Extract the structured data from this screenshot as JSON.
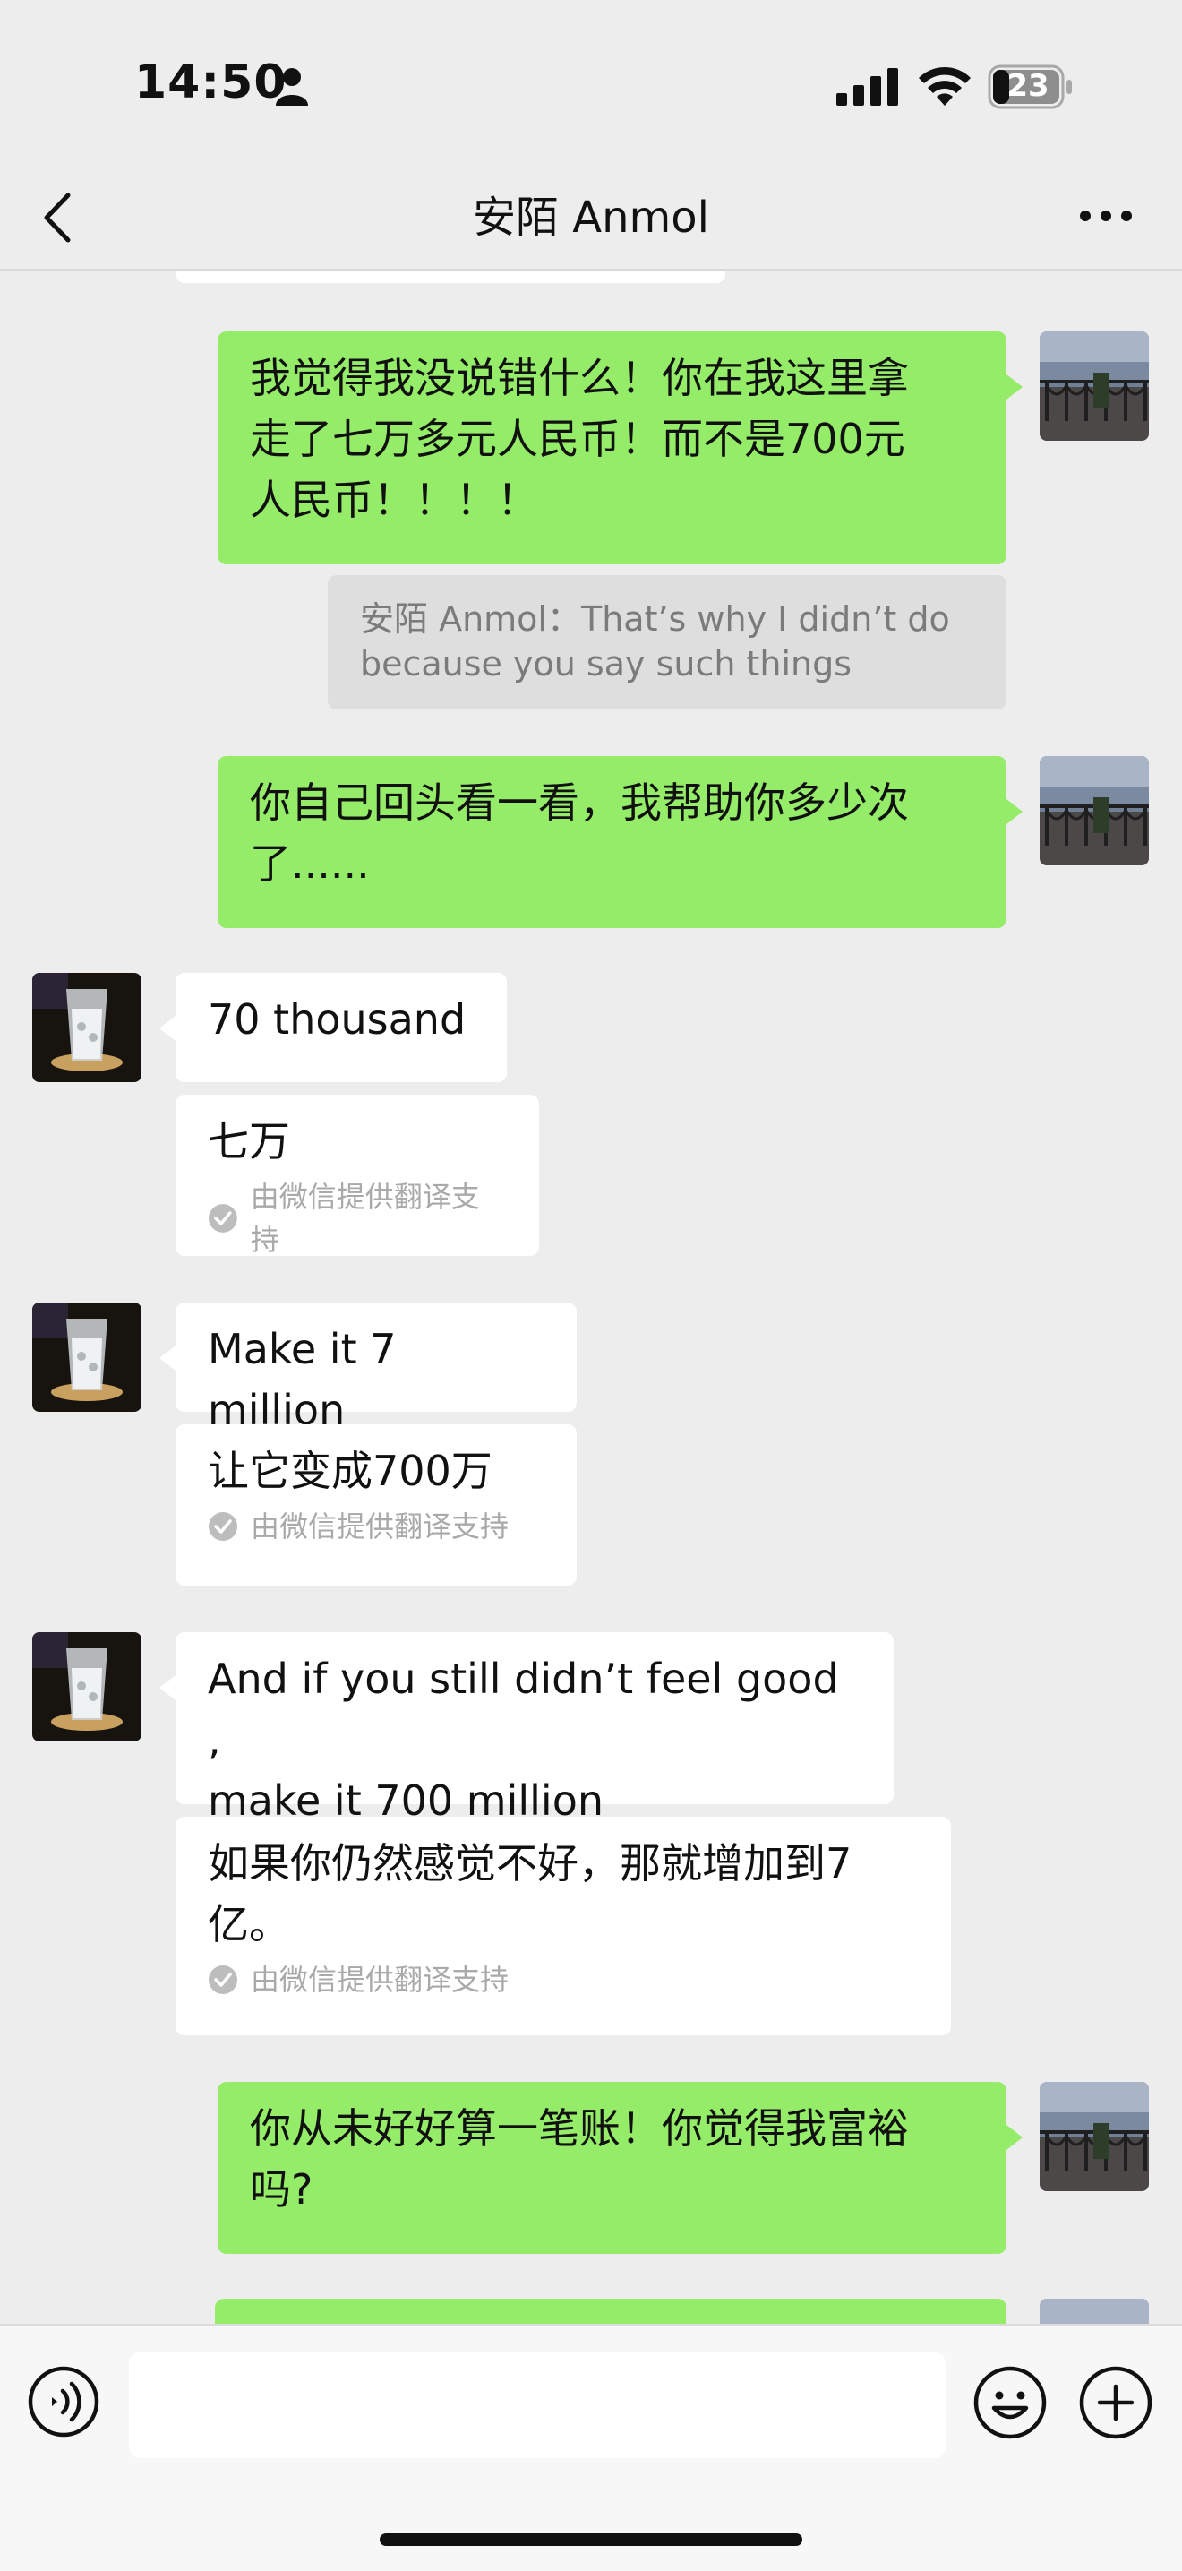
{
  "status_bar": {
    "time": "14:50",
    "battery": "23"
  },
  "nav": {
    "title": "安陌 Anmol"
  },
  "messages": {
    "m1": {
      "lines": [
        "我觉得我没说错什么！你在我这里拿",
        "走了七万多元人民币！而不是700元",
        "人民币！！！！"
      ]
    },
    "m1_quote": {
      "lines": [
        "安陌 Anmol：That’s why I didn’t do",
        "because you say such things"
      ]
    },
    "m2": {
      "lines": [
        "你自己回头看一看，我帮助你多少次",
        "了......"
      ]
    },
    "m3": {
      "text": "70 thousand",
      "translation": "七万"
    },
    "m4": {
      "text": "Make it 7 million",
      "translation": "让它变成700万"
    },
    "m5": {
      "lines": [
        "And if you still didn’t feel good ,",
        "make it 700 million"
      ],
      "translation_lines": [
        "如果你仍然感觉不好，那就增加到7",
        "亿。"
      ]
    },
    "m6": {
      "lines": [
        "你从未好好算一笔账！你觉得我富裕",
        "吗?"
      ]
    },
    "translation_note": "由微信提供翻译支持"
  },
  "input": {
    "value": ""
  },
  "colors": {
    "sent_bubble": "#95ec69",
    "received_bubble": "#ffffff",
    "background": "#ededed"
  },
  "icons": [
    "person-icon",
    "signal-icon",
    "wifi-icon",
    "battery-icon",
    "back-icon",
    "more-icon",
    "voice-icon",
    "emoji-icon",
    "plus-icon",
    "check-icon"
  ]
}
